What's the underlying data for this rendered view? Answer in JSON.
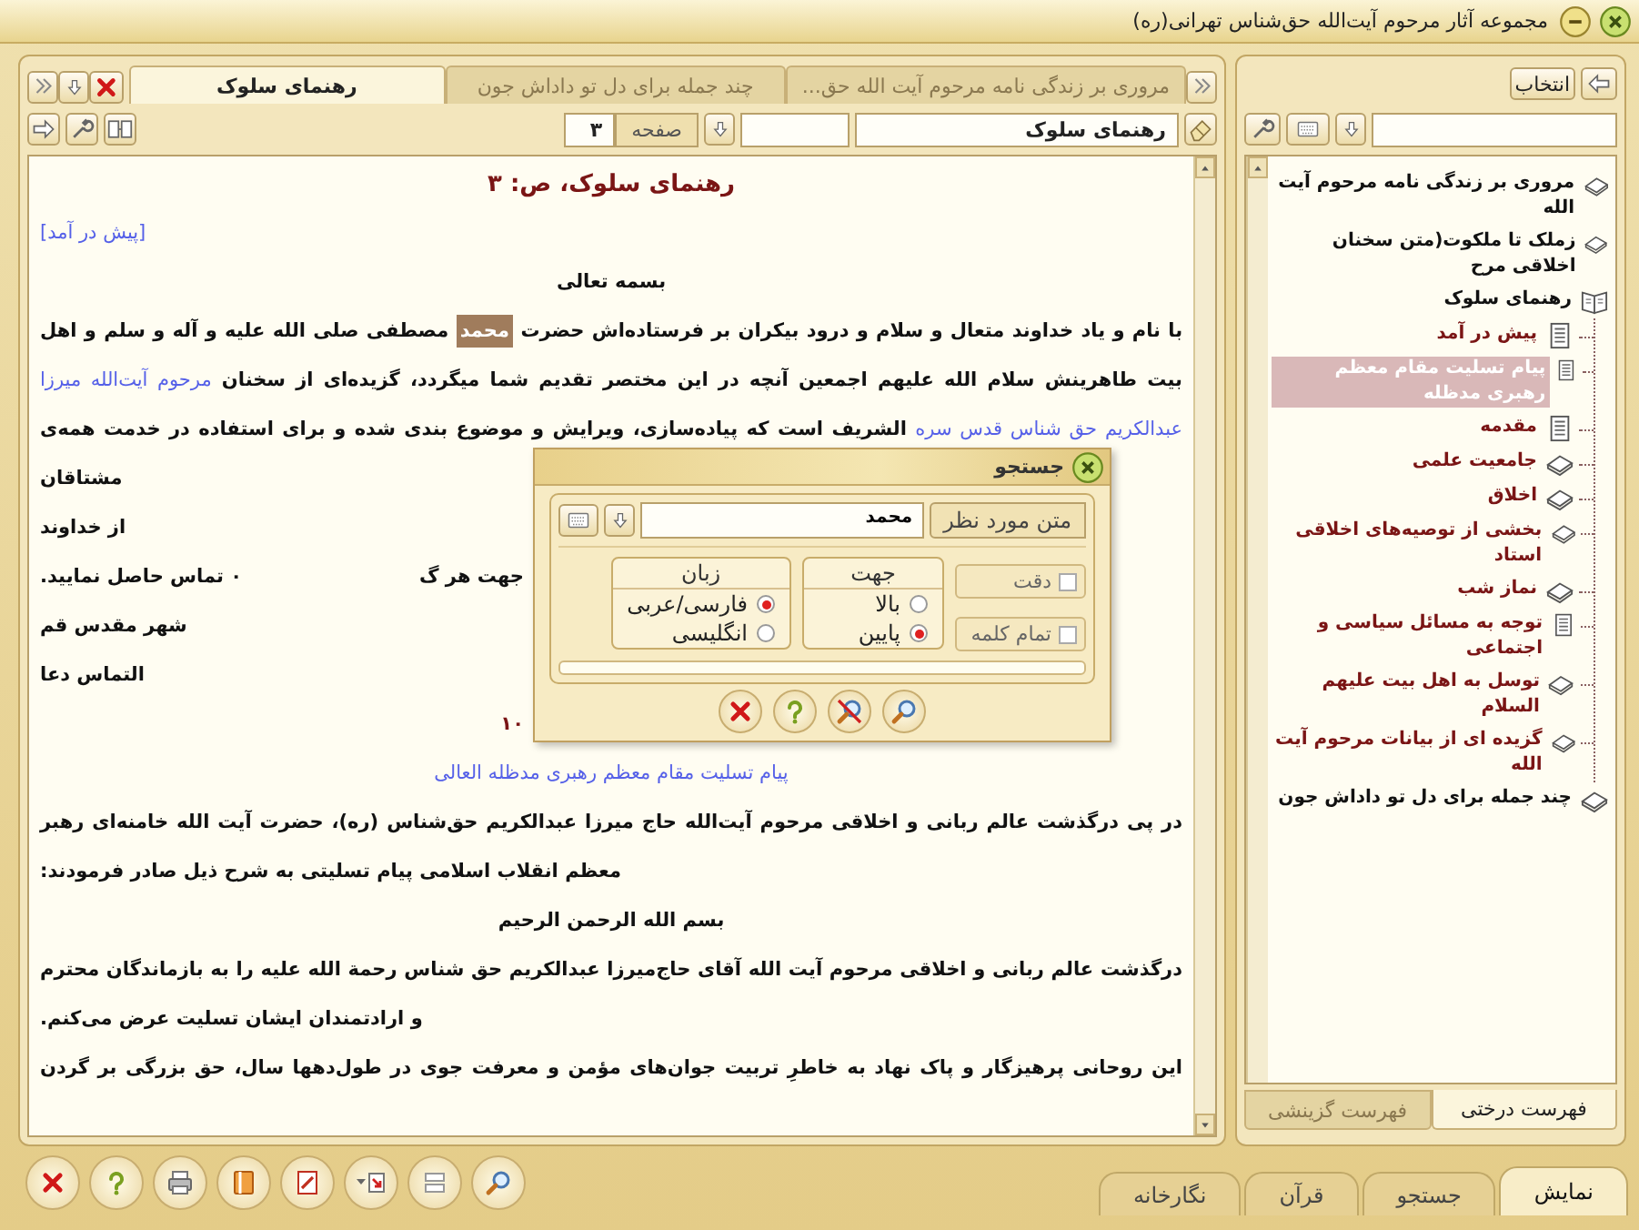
{
  "window": {
    "title": "مجموعه آثار مرحوم آیت‌الله حق‌شناس تهرانی(ره)"
  },
  "document_tabs": [
    {
      "label": "مروری بر زندگی نامه مرحوم آیت الله حق...",
      "selected": false
    },
    {
      "label": "چند جمله برای دل تو داداش جون",
      "selected": false
    },
    {
      "label": "رهنمای سلوک",
      "selected": true
    }
  ],
  "toolbar": {
    "book_value": "رهنمای سلوک",
    "page_label": "صفحه",
    "page_value": "۳"
  },
  "content": {
    "lines": [
      {
        "kind": "heading",
        "segments": [
          {
            "kind": "text",
            "text": "رهنمای سلوک، ص: ۳"
          }
        ]
      },
      {
        "kind": "short",
        "segments": [
          {
            "kind": "link",
            "text": "[پیش در آمد]"
          }
        ]
      },
      {
        "kind": "centered",
        "segments": [
          {
            "kind": "text",
            "text": "بسمه تعالی"
          }
        ]
      },
      {
        "kind": "paragraph",
        "segments": [
          {
            "kind": "text",
            "text": "با نام و یاد خداوند متعال و سلام و درود بیکران بر فرستاده‌اش حضرت"
          },
          {
            "kind": "highlight",
            "text": "محمد"
          },
          {
            "kind": "text",
            "text": "مصطفی صلی الله علیه و آله و سلم و اهل"
          }
        ]
      },
      {
        "kind": "paragraph",
        "segments": [
          {
            "kind": "text",
            "text": "بیت طاهرینش سلام الله علیهم اجمعین آنچه در این مختصر تقدیم شما میگردد، گزیده‌ای از سخنان"
          },
          {
            "kind": "link",
            "text": "مرحوم آیت‌الله میرزا"
          }
        ]
      },
      {
        "kind": "paragraph",
        "segments": [
          {
            "kind": "link",
            "text": "عبدالکریم حق شناس قدس سره"
          },
          {
            "kind": "text",
            "text": "الشریف است که پیاده‌سازی، ویرایش و موضوع بندی شده و برای استفاده در خدمت همه‌ی"
          }
        ]
      },
      {
        "kind": "short",
        "segments": [
          {
            "kind": "text",
            "text": "مشتاقان"
          }
        ]
      },
      {
        "kind": "short",
        "segments": [
          {
            "kind": "text",
            "text": "از خداوند"
          }
        ]
      },
      {
        "kind": "split",
        "segments": [
          {
            "kind": "text",
            "text": "جهت هر گ"
          },
          {
            "kind": "text",
            "text": "۰ تماس حاصل نمایید."
          }
        ]
      },
      {
        "kind": "short",
        "segments": [
          {
            "kind": "text",
            "text": "شهر مقدس قم"
          }
        ]
      },
      {
        "kind": "short",
        "segments": [
          {
            "kind": "text",
            "text": "التماس دعا"
          }
        ]
      },
      {
        "kind": "page-number",
        "segments": [
          {
            "kind": "text",
            "text": "۱۰"
          }
        ]
      },
      {
        "kind": "centered",
        "segments": [
          {
            "kind": "link",
            "text": "پیام تسلیت مقام معظم رهبری مدظله العالی"
          }
        ]
      },
      {
        "kind": "paragraph",
        "segments": [
          {
            "kind": "text",
            "text": "در پی درگذشت عالم ربانی و اخلاقی مرحوم آیت‌الله حاج میرزا عبدالکریم حق‌شناس (ره)، حضرت آیت الله خامنه‌ای رهبر"
          }
        ]
      },
      {
        "kind": "short",
        "segments": [
          {
            "kind": "text",
            "text": "معظم انقلاب اسلامی پیام تسلیتی به شرح ذیل صادر فرمودند:"
          }
        ]
      },
      {
        "kind": "centered",
        "segments": [
          {
            "kind": "text",
            "text": "بسم الله الرحمن الرحیم"
          }
        ]
      },
      {
        "kind": "paragraph",
        "segments": [
          {
            "kind": "text",
            "text": "درگذشت عالم ربانی و اخلاقی مرحوم آیت الله آقای حاج‌میرزا عبدالکریم حق شناس رحمة الله علیه را به بازماندگان محترم"
          }
        ]
      },
      {
        "kind": "short",
        "segments": [
          {
            "kind": "text",
            "text": "و ارادتمندان ایشان تسلیت عرض می‌کنم."
          }
        ]
      },
      {
        "kind": "paragraph",
        "segments": [
          {
            "kind": "text",
            "text": "این روحانی پرهیزگار و پاک نهاد به خاطرِ تربیت جوان‌های مؤمن و معرفت جوی در طول‌دهها سال، حق بزرگی بر گردن"
          }
        ]
      }
    ]
  },
  "search_dialog": {
    "title": "جستجو",
    "field_label": "متن مورد نظر",
    "value": "محمد",
    "checkboxes": [
      {
        "label": "دقت",
        "checked": false
      },
      {
        "label": "تمام کلمه",
        "checked": false
      }
    ],
    "direction": {
      "title": "جهت",
      "options": [
        {
          "label": "بالا",
          "selected": false
        },
        {
          "label": "پایین",
          "selected": true
        }
      ]
    },
    "language": {
      "title": "زبان",
      "options": [
        {
          "label": "فارسی/عربی",
          "selected": true
        },
        {
          "label": "انگلیسی",
          "selected": false
        }
      ]
    }
  },
  "sidebar": {
    "select_button": "انتخاب",
    "tree": [
      {
        "label": "مروری بر زندگی نامه مرحوم آیت الله",
        "kind": "book",
        "selected": false
      },
      {
        "label": "زملک تا ملکوت(متن سخنان اخلاقی مرح",
        "kind": "book",
        "selected": false
      },
      {
        "label": "رهنمای سلوک",
        "kind": "book",
        "selected": false,
        "expanded": true,
        "children": [
          {
            "label": "پیش در آمد",
            "kind": "page",
            "selected": false
          },
          {
            "label": "پیام تسلیت مقام معظم رهبری مدظله",
            "kind": "page",
            "selected": true
          },
          {
            "label": "مقدمه",
            "kind": "page",
            "selected": false
          },
          {
            "label": "جامعیت علمی",
            "kind": "book",
            "selected": false
          },
          {
            "label": "اخلاق",
            "kind": "book",
            "selected": false
          },
          {
            "label": "بخشی از توصیه‌های اخلاقی استاد",
            "kind": "book",
            "selected": false
          },
          {
            "label": "نماز شب",
            "kind": "book",
            "selected": false
          },
          {
            "label": "توجه به مسائل سیاسی و اجتماعی",
            "kind": "page",
            "selected": false
          },
          {
            "label": "توسل به اهل بیت علیهم السلام",
            "kind": "book",
            "selected": false
          },
          {
            "label": "گزیده ای از بیانات مرحوم آیت الله",
            "kind": "book",
            "selected": false
          }
        ]
      },
      {
        "label": "چند جمله برای دل تو داداش جون",
        "kind": "book",
        "selected": false
      }
    ],
    "tabs": [
      {
        "label": "فهرست درختی",
        "selected": true
      },
      {
        "label": "فهرست گزینشی",
        "selected": false
      }
    ]
  },
  "bottom_tabs": [
    {
      "label": "نمایش",
      "selected": true
    },
    {
      "label": "جستجو",
      "selected": false
    },
    {
      "label": "قرآن",
      "selected": false
    },
    {
      "label": "نگارخانه",
      "selected": false
    }
  ]
}
